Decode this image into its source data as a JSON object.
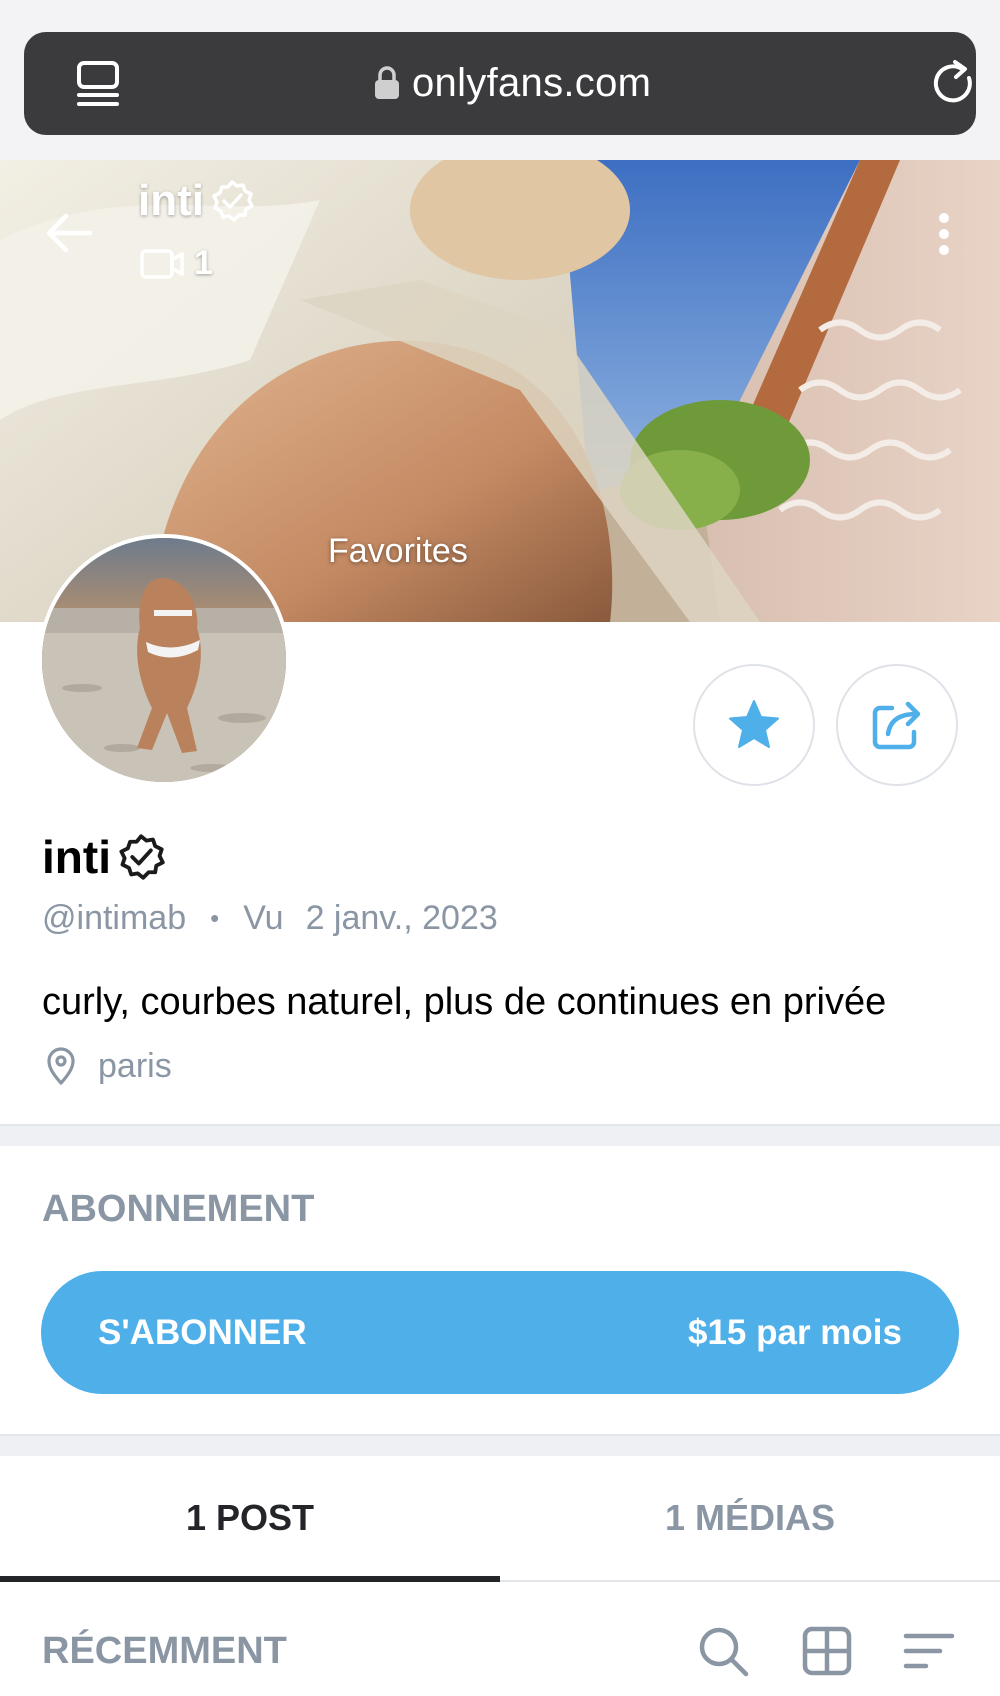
{
  "browser": {
    "url": "onlyfans.com"
  },
  "cover": {
    "name": "inti",
    "video_count": "1",
    "favorites_label": "Favorites"
  },
  "profile": {
    "name": "inti",
    "handle": "@intimab",
    "separator": "•",
    "seen_label": "Vu",
    "seen_date": "2 janv., 2023",
    "bio": "curly, courbes naturel, plus de continues en privée",
    "location": "paris"
  },
  "subscription": {
    "heading": "ABONNEMENT",
    "button_label": "S'ABONNER",
    "price": "$15 par mois"
  },
  "tabs": [
    {
      "label": "1 POST",
      "active": true
    },
    {
      "label": "1 MÉDIAS",
      "active": false
    }
  ],
  "sort": {
    "label": "RÉCEMMENT"
  },
  "colors": {
    "accent": "#4fafe9",
    "muted_text": "#8a96a3",
    "url_bar": "#3b3b3d"
  },
  "icons": [
    "tabs-icon",
    "lock-icon",
    "reload-icon",
    "back-icon",
    "verified-icon",
    "video-icon",
    "more-icon",
    "star-icon",
    "share-icon",
    "pin-icon",
    "search-icon",
    "grid-icon",
    "sort-icon"
  ]
}
